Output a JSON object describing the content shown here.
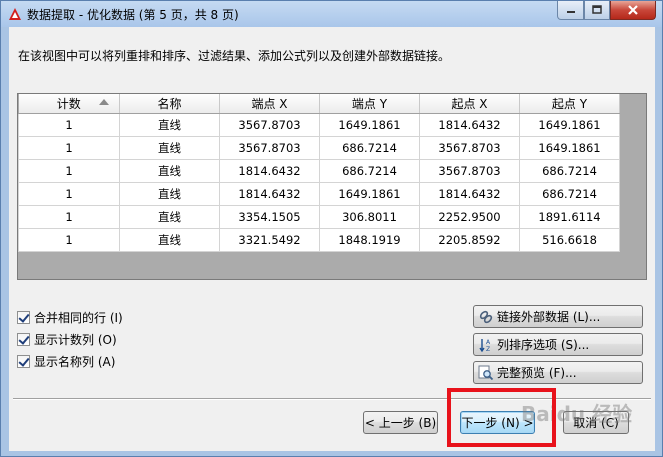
{
  "window": {
    "title": "数据提取 - 优化数据 (第 5 页，共 8 页)"
  },
  "instruction": "在该视图中可以将列重排和排序、过滤结果、添加公式列以及创建外部数据链接。",
  "table": {
    "columns": [
      "计数",
      "名称",
      "端点 X",
      "端点 Y",
      "起点 X",
      "起点 Y"
    ],
    "rows": [
      [
        "1",
        "直线",
        "3567.8703",
        "1649.1861",
        "1814.6432",
        "1649.1861"
      ],
      [
        "1",
        "直线",
        "3567.8703",
        "686.7214",
        "3567.8703",
        "1649.1861"
      ],
      [
        "1",
        "直线",
        "1814.6432",
        "686.7214",
        "3567.8703",
        "686.7214"
      ],
      [
        "1",
        "直线",
        "1814.6432",
        "1649.1861",
        "1814.6432",
        "686.7214"
      ],
      [
        "1",
        "直线",
        "3354.1505",
        "306.8011",
        "2252.9500",
        "1891.6114"
      ],
      [
        "1",
        "直线",
        "3321.5492",
        "1848.1919",
        "2205.8592",
        "516.6618"
      ]
    ]
  },
  "options": {
    "merge_rows": "合并相同的行 (I)",
    "show_count": "显示计数列 (O)",
    "show_name": "显示名称列 (A)"
  },
  "buttons": {
    "link_external": "链接外部数据 (L)...",
    "sort_options": "列排序选项 (S)...",
    "full_preview": "完整预览 (F)...",
    "prev": "< 上一步 (B)",
    "next": "下一步 (N) >",
    "cancel": "取消 (C)"
  },
  "watermark": "Baidu 经验",
  "colors": {
    "highlight": "#e8121b",
    "close_button": "#c8473a"
  }
}
